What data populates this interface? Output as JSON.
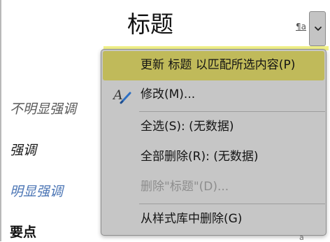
{
  "styles_pane": {
    "title_style": "标题",
    "paragraph_mark": "¶a",
    "items": [
      "不明显强调",
      "强调",
      "明显强调",
      "要点"
    ],
    "right_mark": "a"
  },
  "context_menu": {
    "items": {
      "update": "更新 标题 以匹配所选内容(P)",
      "modify": "修改(M)...",
      "select_all": "全选(S): (无数据)",
      "delete_all": "全部删除(R): (无数据)",
      "delete": "删除\"标题\"(D)...",
      "remove_from_gallery": "从样式库中删除(G)"
    }
  },
  "colors": {
    "menu_background": "#c6c6c6",
    "highlight": "#c0ba5a",
    "intense_emphasis": "#4a74b4",
    "disabled_text": "#8d8d8d"
  },
  "icons": {
    "dropdown": "chevron-down-icon",
    "modify": "pen-icon"
  }
}
